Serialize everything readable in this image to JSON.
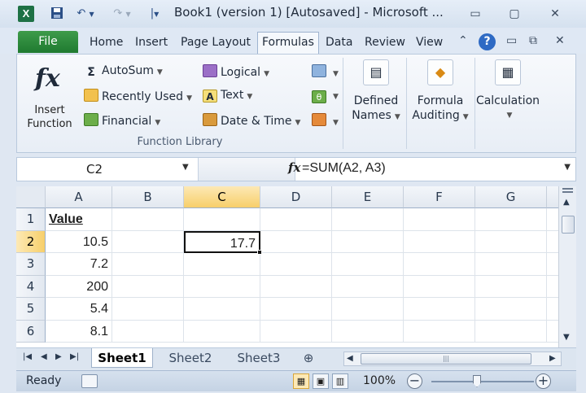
{
  "window": {
    "title": "Book1 (version 1) [Autosaved] - Microsoft ...",
    "app_icon": "X",
    "controls": {
      "minimize": "▭",
      "restore": "▢",
      "close": "✕"
    }
  },
  "quick_access": {
    "save_icon": "save-icon",
    "undo_icon": "undo-icon",
    "redo_icon": "redo-icon"
  },
  "tabs": {
    "file": "File",
    "items": [
      "Home",
      "Insert",
      "Page Layout",
      "Formulas",
      "Data",
      "Review",
      "View"
    ],
    "active": "Formulas"
  },
  "ribbon": {
    "insert_function": {
      "icon_text": "fx",
      "label_line1": "Insert",
      "label_line2": "Function"
    },
    "col1": {
      "autosum": "AutoSum",
      "recently_used": "Recently Used",
      "financial": "Financial"
    },
    "col2": {
      "logical": "Logical",
      "text": "Text",
      "date_time": "Date & Time"
    },
    "group_label": "Function Library",
    "defined_names": {
      "line1": "Defined",
      "line2": "Names"
    },
    "formula_auditing": {
      "line1": "Formula",
      "line2": "Auditing"
    },
    "calculation": {
      "line1": "Calculation"
    }
  },
  "formula_bar": {
    "name_box": "C2",
    "fx_label": "fx",
    "formula": "=SUM(A2, A3)"
  },
  "grid": {
    "columns": [
      "A",
      "B",
      "C",
      "D",
      "E",
      "F",
      "G"
    ],
    "selected_column": "C",
    "rows": [
      "1",
      "2",
      "3",
      "4",
      "5",
      "6"
    ],
    "selected_row": "2",
    "cells": {
      "A1": "Value",
      "A2": "10.5",
      "A3": "7.2",
      "A4": "200",
      "A5": "5.4",
      "A6": "8.1",
      "C2": "17.7"
    },
    "active_cell": "C2"
  },
  "sheets": {
    "tabs": [
      "Sheet1",
      "Sheet2",
      "Sheet3"
    ],
    "active": "Sheet1"
  },
  "status": {
    "ready": "Ready",
    "zoom": "100%",
    "zoom_minus": "−",
    "zoom_plus": "+"
  }
}
